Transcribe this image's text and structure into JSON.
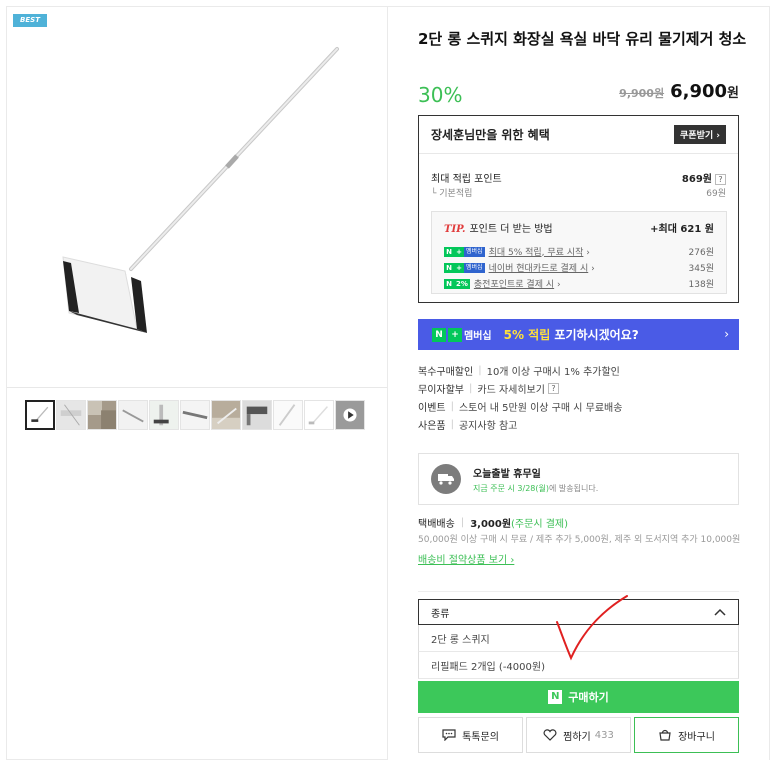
{
  "left": {
    "best_badge": "BEST",
    "thumbnail_count": 11
  },
  "product": {
    "title": "2단 롱 스퀴지 화장실 욕실 바닥 유리 물기제거 청소",
    "discount": "30%",
    "original_price": "9,900원",
    "price": "6,900",
    "currency": "원"
  },
  "benefit": {
    "title": "장세훈님만을 위한 혜택",
    "coupon_button": "쿠폰받기",
    "max_points_label": "최대 적립 포인트",
    "max_points_value": "869원",
    "basic_label": "기본적립",
    "basic_value": "69원",
    "tip_label": "TIP.",
    "tip_title": "포인트 더 받는 방법",
    "tip_max": "+최대 621 원",
    "tips": [
      {
        "badge": "멤버십",
        "label": "최대 5% 적립, 무료 시작",
        "value": "276원"
      },
      {
        "badge": "멤버십",
        "label": "네이버 현대카드로 결제 시",
        "value": "345원"
      },
      {
        "badge": "2%",
        "label": "충전포인트로 결제 시",
        "value": "138원"
      }
    ]
  },
  "banner": {
    "logo_text": "멤버십",
    "text_highlight": "5% 적립",
    "text_rest": " 포기하시겠어요?",
    "arrow": "›"
  },
  "info": [
    {
      "key": "복수구매할인",
      "value": "10개 이상 구매시 1% 추가할인"
    },
    {
      "key": "무이자할부",
      "value": "카드 자세히보기"
    },
    {
      "key": "이벤트",
      "value": "스토어 내 5만원 이상 구매 시 무료배송"
    },
    {
      "key": "사은품",
      "value": "공지사항 참고"
    }
  ],
  "delivery": {
    "title": "오늘출발 휴무일",
    "sub_highlight": "지금 주문 시 3/28(월)",
    "sub_rest": "에 발송됩니다."
  },
  "shipping": {
    "method": "택배배송",
    "fee": "3,000원",
    "fee_note": "(주문시 결제)",
    "description": "50,000원 이상 구매 시 무료 / 제주 추가 5,000원, 제주 외 도서지역 추가 10,000원",
    "link": "배송비 절약상품 보기 ›"
  },
  "options": {
    "header": "종류",
    "items": [
      "2단 롱 스퀴지",
      "리필패드 2개입 (-4000원)"
    ]
  },
  "actions": {
    "buy": "구매하기",
    "talk": "톡톡문의",
    "wish": "찜하기",
    "wish_count": "433",
    "cart": "장바구니"
  },
  "colors": {
    "accent_green": "#3cc85a",
    "banner_blue": "#4a5be6",
    "best_badge": "#4fb2d8"
  }
}
